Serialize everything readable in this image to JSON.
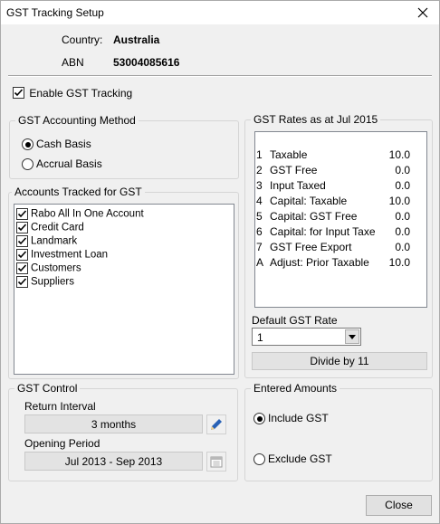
{
  "window": {
    "title": "GST Tracking Setup"
  },
  "header": {
    "country_label": "Country:",
    "country_value": "Australia",
    "abn_label": "ABN",
    "abn_value": "53004085616"
  },
  "enable_tracking": {
    "label": "Enable GST Tracking",
    "checked": true
  },
  "accounting_method": {
    "title": "GST Accounting Method",
    "options": [
      {
        "label": "Cash Basis",
        "selected": true
      },
      {
        "label": "Accrual Basis",
        "selected": false
      }
    ]
  },
  "accounts": {
    "title": "Accounts Tracked for GST",
    "items": [
      {
        "label": "Rabo All In One Account",
        "checked": true
      },
      {
        "label": "Credit Card",
        "checked": true
      },
      {
        "label": "Landmark",
        "checked": true
      },
      {
        "label": "Investment Loan",
        "checked": true
      },
      {
        "label": "Customers",
        "checked": true
      },
      {
        "label": "Suppliers",
        "checked": true
      }
    ]
  },
  "gst_rates": {
    "title": "GST Rates as at Jul 2015",
    "rows": [
      {
        "code": "1",
        "name": "Taxable",
        "rate": "10.0"
      },
      {
        "code": "2",
        "name": "GST Free",
        "rate": "0.0"
      },
      {
        "code": "3",
        "name": "Input Taxed",
        "rate": "0.0"
      },
      {
        "code": "4",
        "name": "Capital: Taxable",
        "rate": "10.0"
      },
      {
        "code": "5",
        "name": "Capital: GST Free",
        "rate": "0.0"
      },
      {
        "code": "6",
        "name": "Capital: for Input Taxe",
        "rate": "0.0"
      },
      {
        "code": "7",
        "name": "GST Free Export",
        "rate": "0.0"
      },
      {
        "code": "A",
        "name": "Adjust: Prior Taxable",
        "rate": "10.0"
      }
    ],
    "default_label": "Default GST Rate",
    "default_value": "1",
    "divide_text": "Divide by 11"
  },
  "gst_control": {
    "title": "GST Control",
    "return_interval_label": "Return Interval",
    "return_interval_value": "3 months",
    "opening_period_label": "Opening Period",
    "opening_period_value": "Jul 2013 - Sep 2013"
  },
  "entered_amounts": {
    "title": "Entered Amounts",
    "options": [
      {
        "label": "Include GST",
        "selected": true
      },
      {
        "label": "Exclude GST",
        "selected": false
      }
    ]
  },
  "footer": {
    "close_label": "Close"
  }
}
